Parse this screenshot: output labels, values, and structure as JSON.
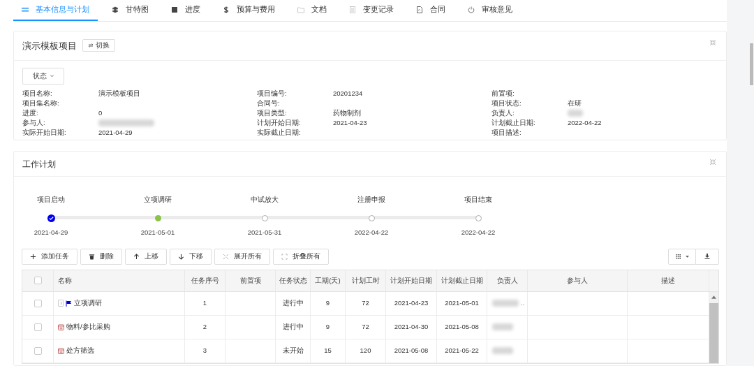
{
  "tabs": [
    {
      "label": "基本信息与计划",
      "kind": "list",
      "selected": true
    },
    {
      "label": "甘特图",
      "kind": "layers",
      "selected": false
    },
    {
      "label": "进度",
      "kind": "square",
      "selected": false
    },
    {
      "label": "预算与费用",
      "kind": "dollar",
      "selected": false
    },
    {
      "label": "文档",
      "kind": "folder",
      "selected": false
    },
    {
      "label": "变更记录",
      "kind": "doc",
      "selected": false
    },
    {
      "label": "合同",
      "kind": "file",
      "selected": false
    },
    {
      "label": "审核意见",
      "kind": "power",
      "selected": false
    }
  ],
  "project_card": {
    "title": "演示模板项目",
    "switch_button": "切换",
    "status_button": "状态",
    "fields": [
      [
        {
          "label": "项目名称:",
          "value": "演示模板项目"
        },
        {
          "label": "项目集名称:"
        },
        {
          "label": "进度:",
          "value": "0"
        },
        {
          "label": "参与人:",
          "kind": "blurred"
        },
        {
          "label": "实际开始日期:",
          "value": "2021-04-29"
        }
      ],
      [
        {
          "label": "项目编号:",
          "value": "20201234"
        },
        {
          "label": "合同号:"
        },
        {
          "label": "项目类型:",
          "value": "药物制剂"
        },
        {
          "label": "计划开始日期:",
          "value": "2021-04-23"
        },
        {
          "label": "实际截止日期:"
        }
      ],
      [
        {
          "label": "前置项:"
        },
        {
          "label": "项目状态:",
          "value": "在研"
        },
        {
          "label": "负责人:",
          "kind": "blurred"
        },
        {
          "label": "计划截止日期:",
          "value": "2022-04-22"
        },
        {
          "label": "项目描述:"
        }
      ]
    ]
  },
  "plan_card": {
    "title": "工作计划",
    "milestones": [
      {
        "label": "项目启动",
        "date": "2021-04-29",
        "kind": "done"
      },
      {
        "label": "立项调研",
        "date": "2021-05-01",
        "kind": "current"
      },
      {
        "label": "中试放大",
        "date": "2021-05-31",
        "kind": "pending"
      },
      {
        "label": "注册申报",
        "date": "2022-04-22",
        "kind": "pending"
      },
      {
        "label": "项目结束",
        "date": "2022-04-22",
        "kind": "pending"
      }
    ],
    "toolbar": [
      {
        "label": "添加任务",
        "kind": "plus"
      },
      {
        "label": "删除",
        "kind": "trash"
      },
      {
        "label": "上移",
        "kind": "up"
      },
      {
        "label": "下移",
        "kind": "down"
      },
      {
        "label": "展开所有",
        "kind": "expand"
      },
      {
        "label": "折叠所有",
        "kind": "collapse"
      }
    ],
    "table": {
      "all_checked": false,
      "columns": [
        "名称",
        "任务序号",
        "前置项",
        "任务状态",
        "工期(天)",
        "计划工时",
        "计划开始日期",
        "计划截止日期",
        "负责人",
        "参与人",
        "描述"
      ],
      "rows": [
        {
          "checked": false,
          "kind": "milestone",
          "name": "立项调研",
          "number": "1",
          "status": "进行中",
          "days": "9",
          "hours": "72",
          "start": "2021-04-23",
          "end": "2021-05-01",
          "owner_suffix": ".."
        },
        {
          "checked": false,
          "kind": "task",
          "name": "物料/参比采购",
          "number": "2",
          "status": "进行中",
          "days": "9",
          "hours": "72",
          "start": "2021-04-30",
          "end": "2021-05-08"
        },
        {
          "checked": false,
          "kind": "task",
          "name": "处方筛选",
          "number": "3",
          "status": "未开始",
          "days": "15",
          "hours": "120",
          "start": "2021-05-08",
          "end": "2021-05-22"
        }
      ]
    }
  }
}
